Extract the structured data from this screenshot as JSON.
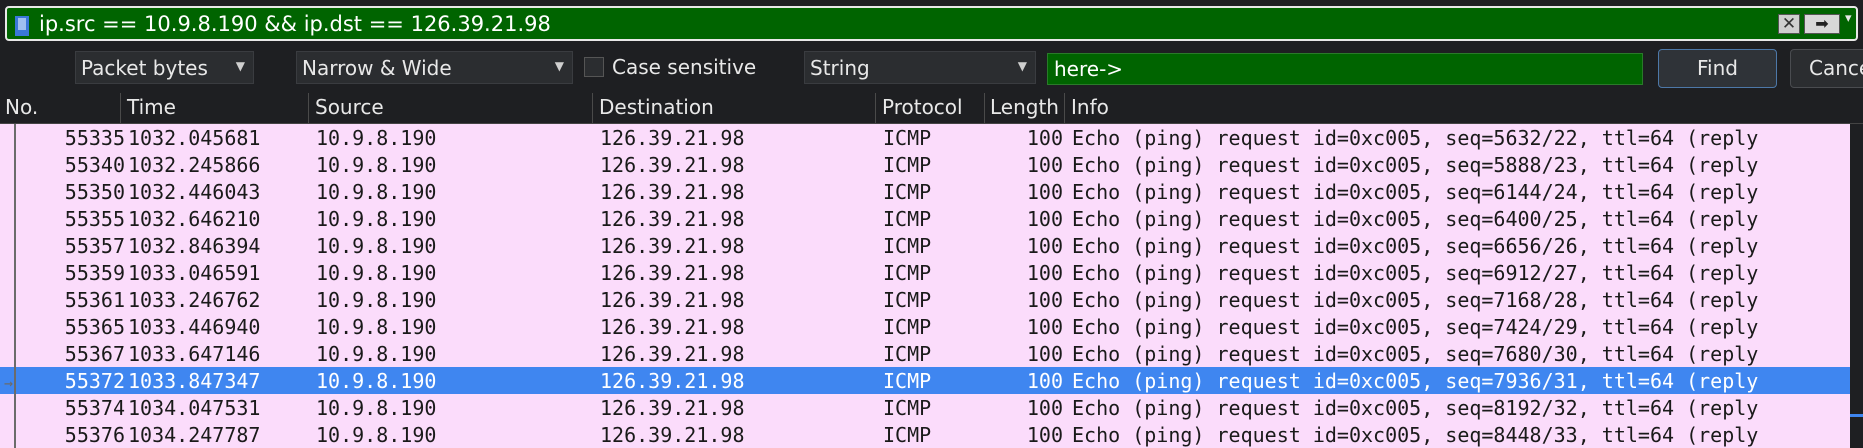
{
  "filter": {
    "expression": "ip.src == 10.9.8.190 && ip.dst == 126.39.21.98",
    "clear_icon": "✕",
    "apply_icon": "➡",
    "history_icon": "▾"
  },
  "find": {
    "search_in": "Packet bytes",
    "character_width": "Narrow & Wide",
    "case_sensitive_label": "Case sensitive",
    "search_type": "String",
    "search_value": "here->",
    "find_label": "Find",
    "cancel_label": "Cancel"
  },
  "columns": [
    "No.",
    "Time",
    "Source",
    "Destination",
    "Protocol",
    "Length",
    "Info"
  ],
  "packets": [
    {
      "no": "55335",
      "time": "1032.045681",
      "src": "10.9.8.190",
      "dst": "126.39.21.98",
      "proto": "ICMP",
      "len": "100",
      "info": "Echo (ping) request  id=0xc005, seq=5632/22, ttl=64 (reply"
    },
    {
      "no": "55340",
      "time": "1032.245866",
      "src": "10.9.8.190",
      "dst": "126.39.21.98",
      "proto": "ICMP",
      "len": "100",
      "info": "Echo (ping) request  id=0xc005, seq=5888/23, ttl=64 (reply"
    },
    {
      "no": "55350",
      "time": "1032.446043",
      "src": "10.9.8.190",
      "dst": "126.39.21.98",
      "proto": "ICMP",
      "len": "100",
      "info": "Echo (ping) request  id=0xc005, seq=6144/24, ttl=64 (reply"
    },
    {
      "no": "55355",
      "time": "1032.646210",
      "src": "10.9.8.190",
      "dst": "126.39.21.98",
      "proto": "ICMP",
      "len": "100",
      "info": "Echo (ping) request  id=0xc005, seq=6400/25, ttl=64 (reply"
    },
    {
      "no": "55357",
      "time": "1032.846394",
      "src": "10.9.8.190",
      "dst": "126.39.21.98",
      "proto": "ICMP",
      "len": "100",
      "info": "Echo (ping) request  id=0xc005, seq=6656/26, ttl=64 (reply"
    },
    {
      "no": "55359",
      "time": "1033.046591",
      "src": "10.9.8.190",
      "dst": "126.39.21.98",
      "proto": "ICMP",
      "len": "100",
      "info": "Echo (ping) request  id=0xc005, seq=6912/27, ttl=64 (reply"
    },
    {
      "no": "55361",
      "time": "1033.246762",
      "src": "10.9.8.190",
      "dst": "126.39.21.98",
      "proto": "ICMP",
      "len": "100",
      "info": "Echo (ping) request  id=0xc005, seq=7168/28, ttl=64 (reply"
    },
    {
      "no": "55365",
      "time": "1033.446940",
      "src": "10.9.8.190",
      "dst": "126.39.21.98",
      "proto": "ICMP",
      "len": "100",
      "info": "Echo (ping) request  id=0xc005, seq=7424/29, ttl=64 (reply"
    },
    {
      "no": "55367",
      "time": "1033.647146",
      "src": "10.9.8.190",
      "dst": "126.39.21.98",
      "proto": "ICMP",
      "len": "100",
      "info": "Echo (ping) request  id=0xc005, seq=7680/30, ttl=64 (reply"
    },
    {
      "no": "55372",
      "time": "1033.847347",
      "src": "10.9.8.190",
      "dst": "126.39.21.98",
      "proto": "ICMP",
      "len": "100",
      "info": "Echo (ping) request  id=0xc005, seq=7936/31, ttl=64 (reply",
      "selected": true
    },
    {
      "no": "55374",
      "time": "1034.047531",
      "src": "10.9.8.190",
      "dst": "126.39.21.98",
      "proto": "ICMP",
      "len": "100",
      "info": "Echo (ping) request  id=0xc005, seq=8192/32, ttl=64 (reply"
    },
    {
      "no": "55376",
      "time": "1034.247787",
      "src": "10.9.8.190",
      "dst": "126.39.21.98",
      "proto": "ICMP",
      "len": "100",
      "info": "Echo (ping) request  id=0xc005, seq=8448/33, ttl=64 (reply"
    }
  ],
  "colors": {
    "filter_valid": "#006400",
    "row_background": "#fbdcfb",
    "selection": "#3f86f0"
  }
}
